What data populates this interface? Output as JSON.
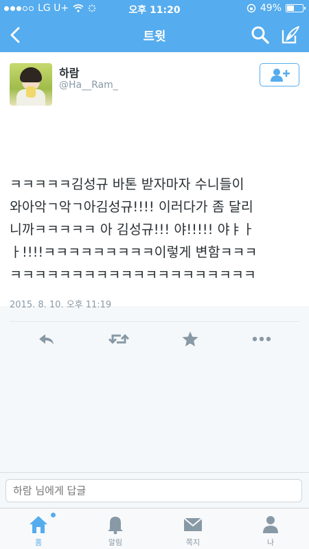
{
  "status_bar": {
    "carrier": "LG U+",
    "time": "오후 11:20",
    "battery": "49%",
    "battery_level": 0.49
  },
  "nav": {
    "title": "트윗",
    "back_icon": "chevron-left-icon",
    "search_icon": "search-icon",
    "compose_icon": "compose-icon"
  },
  "tweet": {
    "user_name": "하람",
    "handle": "@Ha__Ram_",
    "lines": [
      "ㅋㅋㅋㅋㅋ김성규 바톤 받자마자 수니들이",
      "와아악ㄱ악ㄱ아김성규!!!! 이러다가 좀 달리",
      "니까ㅋㅋㅋㅋㅋ 아 김성규!!! 야!!!!! 야ㅑㅏ",
      "ㅏ!!!!ㅋㅋㅋㅋㅋㅋㅋㅋㅋ이렇게 변함ㅋㅋㅋ",
      "ㅋㅋㅋㅋㅋㅋㅋㅋㅋㅋㅋㅋㅋㅋㅋㅋㅋㅋㅋㅋ"
    ],
    "date": "2015. 8. 10. 오후 11:19",
    "actions": [
      "reply-icon",
      "retweet-icon",
      "favorite-icon",
      "more-icon"
    ]
  },
  "reply": {
    "placeholder": "하람 님에게 답글"
  },
  "tabs": [
    {
      "label": "홈",
      "icon": "home-icon",
      "active": true
    },
    {
      "label": "알림",
      "icon": "bell-icon",
      "active": false
    },
    {
      "label": "쪽지",
      "icon": "envelope-icon",
      "active": false
    },
    {
      "label": "나",
      "icon": "person-icon",
      "active": false
    }
  ],
  "colors": {
    "accent": "#55acee",
    "text": "#292f33",
    "muted": "#8899a6"
  }
}
